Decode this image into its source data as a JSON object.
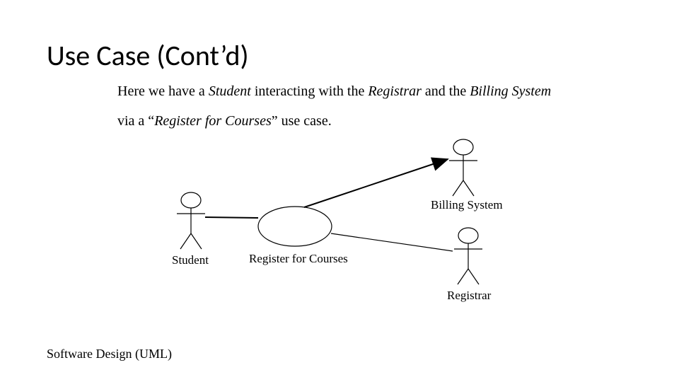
{
  "title": "Use Case (Cont’d)",
  "description": {
    "prefix": "Here we have a ",
    "actor1": "Student",
    "mid1": " interacting with the ",
    "actor2": "Registrar",
    "mid2": " and the ",
    "actor3": "Billing System",
    "mid3": " via a “",
    "usecase": "Register for Courses",
    "suffix": "” use case."
  },
  "diagram": {
    "actors": {
      "student": "Student",
      "billing": "Billing System",
      "registrar": "Registrar"
    },
    "usecase_label": "Register for Courses"
  },
  "footer": "Software Design (UML)"
}
